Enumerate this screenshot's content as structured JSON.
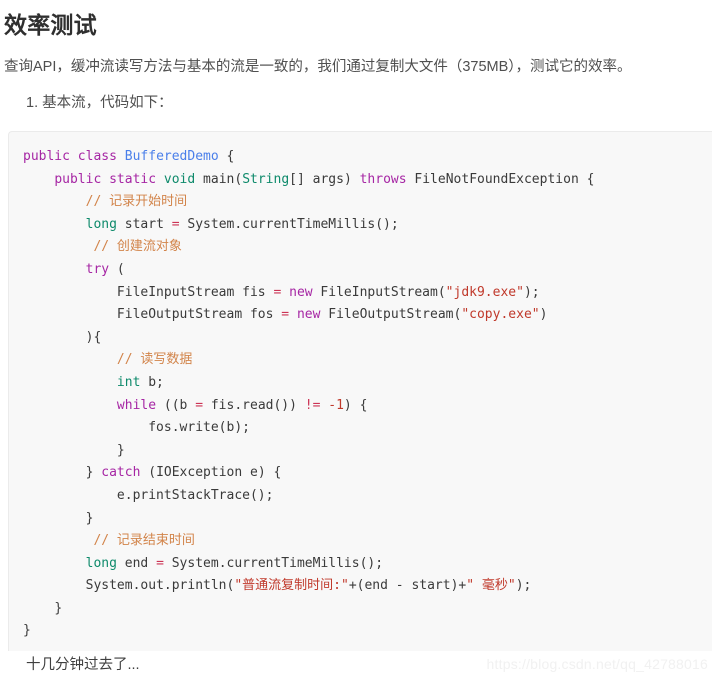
{
  "article": {
    "heading": "效率测试",
    "intro_paragraph": "查询API，缓冲流读写方法与基本的流是一致的，我们通过复制大文件（375MB），测试它的效率。",
    "list_item": "1. 基本流，代码如下：",
    "tail_paragraph": "十几分钟过去了..."
  },
  "code": {
    "language": "java",
    "lines": [
      {
        "indent": 0,
        "tokens": [
          {
            "t": "public",
            "c": "kw"
          },
          {
            "t": " ",
            "c": "pln"
          },
          {
            "t": "class",
            "c": "kw"
          },
          {
            "t": " ",
            "c": "pln"
          },
          {
            "t": "BufferedDemo",
            "c": "cls"
          },
          {
            "t": " {",
            "c": "pln"
          }
        ]
      },
      {
        "indent": 1,
        "tokens": [
          {
            "t": "public",
            "c": "kw"
          },
          {
            "t": " ",
            "c": "pln"
          },
          {
            "t": "static",
            "c": "kw"
          },
          {
            "t": " ",
            "c": "pln"
          },
          {
            "t": "void",
            "c": "typ"
          },
          {
            "t": " main(",
            "c": "pln"
          },
          {
            "t": "String",
            "c": "typ"
          },
          {
            "t": "[] args) ",
            "c": "pln"
          },
          {
            "t": "throws",
            "c": "kw"
          },
          {
            "t": " FileNotFoundException {",
            "c": "pln"
          }
        ]
      },
      {
        "indent": 2,
        "tokens": [
          {
            "t": "// 记录开始时间",
            "c": "cmt"
          }
        ]
      },
      {
        "indent": 2,
        "tokens": [
          {
            "t": "long",
            "c": "typ"
          },
          {
            "t": " start ",
            "c": "pln"
          },
          {
            "t": "=",
            "c": "op"
          },
          {
            "t": " System.currentTimeMillis();",
            "c": "pln"
          }
        ]
      },
      {
        "indent": 2,
        "extra_space": true,
        "tokens": [
          {
            "t": "// 创建流对象",
            "c": "cmt"
          }
        ]
      },
      {
        "indent": 2,
        "tokens": [
          {
            "t": "try",
            "c": "kw"
          },
          {
            "t": " (",
            "c": "pln"
          }
        ]
      },
      {
        "indent": 3,
        "tokens": [
          {
            "t": "FileInputStream fis ",
            "c": "pln"
          },
          {
            "t": "=",
            "c": "op"
          },
          {
            "t": " ",
            "c": "pln"
          },
          {
            "t": "new",
            "c": "kw"
          },
          {
            "t": " FileInputStream(",
            "c": "pln"
          },
          {
            "t": "\"jdk9.exe\"",
            "c": "str"
          },
          {
            "t": ");",
            "c": "pln"
          }
        ]
      },
      {
        "indent": 3,
        "tokens": [
          {
            "t": "FileOutputStream fos ",
            "c": "pln"
          },
          {
            "t": "=",
            "c": "op"
          },
          {
            "t": " ",
            "c": "pln"
          },
          {
            "t": "new",
            "c": "kw"
          },
          {
            "t": " FileOutputStream(",
            "c": "pln"
          },
          {
            "t": "\"copy.exe\"",
            "c": "str"
          },
          {
            "t": ")",
            "c": "pln"
          }
        ]
      },
      {
        "indent": 2,
        "tokens": [
          {
            "t": "){",
            "c": "pln"
          }
        ]
      },
      {
        "indent": 3,
        "tokens": [
          {
            "t": "// 读写数据",
            "c": "cmt"
          }
        ]
      },
      {
        "indent": 3,
        "tokens": [
          {
            "t": "int",
            "c": "typ"
          },
          {
            "t": " b;",
            "c": "pln"
          }
        ]
      },
      {
        "indent": 3,
        "tokens": [
          {
            "t": "while",
            "c": "kw"
          },
          {
            "t": " ((b ",
            "c": "pln"
          },
          {
            "t": "=",
            "c": "op"
          },
          {
            "t": " fis.read()) ",
            "c": "pln"
          },
          {
            "t": "!=",
            "c": "op"
          },
          {
            "t": " ",
            "c": "pln"
          },
          {
            "t": "-1",
            "c": "num"
          },
          {
            "t": ") {",
            "c": "pln"
          }
        ]
      },
      {
        "indent": 4,
        "tokens": [
          {
            "t": "fos.write(b);",
            "c": "pln"
          }
        ]
      },
      {
        "indent": 3,
        "tokens": [
          {
            "t": "}",
            "c": "pln"
          }
        ]
      },
      {
        "indent": 2,
        "tokens": [
          {
            "t": "} ",
            "c": "pln"
          },
          {
            "t": "catch",
            "c": "kw"
          },
          {
            "t": " (IOException e) {",
            "c": "pln"
          }
        ]
      },
      {
        "indent": 3,
        "tokens": [
          {
            "t": "e.printStackTrace();",
            "c": "pln"
          }
        ]
      },
      {
        "indent": 2,
        "tokens": [
          {
            "t": "}",
            "c": "pln"
          }
        ]
      },
      {
        "indent": 2,
        "extra_space": true,
        "tokens": [
          {
            "t": "// 记录结束时间",
            "c": "cmt"
          }
        ]
      },
      {
        "indent": 2,
        "tokens": [
          {
            "t": "long",
            "c": "typ"
          },
          {
            "t": " end ",
            "c": "pln"
          },
          {
            "t": "=",
            "c": "op"
          },
          {
            "t": " System.currentTimeMillis();",
            "c": "pln"
          }
        ]
      },
      {
        "indent": 2,
        "tokens": [
          {
            "t": "System.out.println(",
            "c": "pln"
          },
          {
            "t": "\"普通流复制时间:\"",
            "c": "str"
          },
          {
            "t": "+(end - start)+",
            "c": "pln"
          },
          {
            "t": "\" 毫秒\"",
            "c": "str"
          },
          {
            "t": ");",
            "c": "pln"
          }
        ]
      },
      {
        "indent": 1,
        "tokens": [
          {
            "t": "}",
            "c": "pln"
          }
        ]
      },
      {
        "indent": 0,
        "tokens": [
          {
            "t": "}",
            "c": "pln"
          }
        ]
      }
    ]
  },
  "watermark": {
    "text": "https://blog.csdn.net/qq_42788016"
  },
  "colors": {
    "code_background": "#f8f8f8",
    "code_border": "#ebebeb",
    "keyword": "#a626a4",
    "type": "#0e8a6b",
    "class_name": "#4a7fea",
    "string": "#c0392b",
    "comment": "#d2844a",
    "operator": "#cc3355",
    "text": "#4d4d4d"
  }
}
